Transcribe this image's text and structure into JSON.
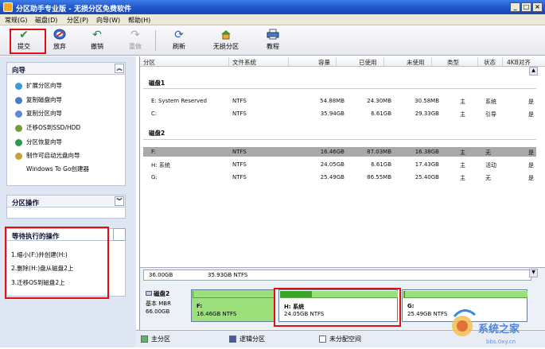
{
  "window": {
    "title": "分区助手专业版 - 无损分区免费软件"
  },
  "menu": [
    "常规(G)",
    "磁盘(D)",
    "分区(P)",
    "向导(W)",
    "帮助(H)"
  ],
  "toolbar": {
    "submit": "提交",
    "discard": "放弃",
    "undo": "撤销",
    "redo": "重做",
    "refresh": "刷新",
    "lossless": "无损分区",
    "tutorial": "教程"
  },
  "wizard": {
    "title": "向导",
    "items": [
      "扩展分区向导",
      "复制磁盘向导",
      "复制分区向导",
      "迁移OS到SSD/HDD",
      "分区恢复向导",
      "制作可启动光盘向导",
      "Windows To Go创建器"
    ]
  },
  "partition_ops": {
    "title": "分区操作"
  },
  "pending": {
    "title": "等待执行的操作",
    "items": [
      "1.缩小(F:)并创建(H:)",
      "2.删除(H:)盘从磁盘2上",
      "3.迁移OS到磁盘2上"
    ]
  },
  "columns": [
    "分区",
    "文件系统",
    "容量",
    "已使用",
    "未使用",
    "类型",
    "状态",
    "4KB对齐"
  ],
  "disk1": {
    "label": "磁盘1",
    "rows": [
      [
        "E: System Reserved",
        "NTFS",
        "54.88MB",
        "24.30MB",
        "30.58MB",
        "主",
        "系统",
        "是"
      ],
      [
        "C:",
        "NTFS",
        "35.94GB",
        "6.61GB",
        "29.33GB",
        "主",
        "引导",
        "是"
      ]
    ]
  },
  "disk2": {
    "label": "磁盘2",
    "rows": [
      [
        "F:",
        "NTFS",
        "16.46GB",
        "87.03MB",
        "16.38GB",
        "主",
        "无",
        "是"
      ],
      [
        "H: 系统",
        "NTFS",
        "24.05GB",
        "6.61GB",
        "17.43GB",
        "主",
        "活动",
        "是"
      ],
      [
        "G:",
        "NTFS",
        "25.49GB",
        "86.55MB",
        "25.40GB",
        "主",
        "无",
        "是"
      ]
    ]
  },
  "map": {
    "prev_size": "36.00GB",
    "prev_fs": "35.93GB NTFS",
    "disk_name": "磁盘2",
    "disk_type": "基本 MBR",
    "disk_size": "66.00GB",
    "parts": [
      {
        "name": "F:",
        "info": "16.46GB NTFS",
        "used_pct": 1
      },
      {
        "name": "H: 系统",
        "info": "24.05GB NTFS",
        "used_pct": 27
      },
      {
        "name": "G:",
        "info": "25.49GB NTFS",
        "used_pct": 1
      }
    ]
  },
  "legend": {
    "primary": "主分区",
    "logical": "逻辑分区",
    "unallocated": "未分配空间"
  },
  "colors": {
    "primary": "#5cb85c",
    "logical": "#3a5cb0",
    "unallocated": "#ffffff",
    "highlight": "#e01010"
  },
  "watermark": {
    "brand": "系统之家",
    "url": "bbs.0xy.cn"
  }
}
